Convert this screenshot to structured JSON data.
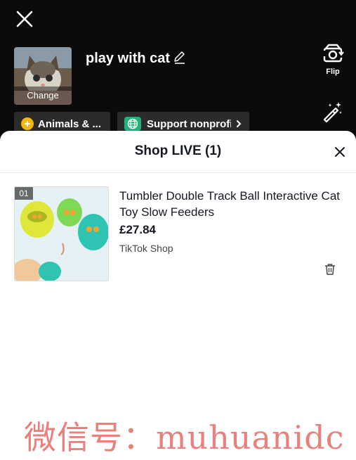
{
  "top": {
    "close_icon": "close-icon",
    "cover": {
      "change_label": "Change"
    },
    "title": "play with cat",
    "edit_icon": "pencil-icon",
    "flip": {
      "icon": "flip-camera-icon",
      "label": "Flip"
    },
    "effects_icon": "magic-wand-icon",
    "topic_pill": {
      "label": "Animals & ...",
      "icon": "topic-dot-icon"
    },
    "nonprofit_pill": {
      "label": "Support nonprofit",
      "icon": "globe-icon",
      "chevron": "chevron-right-icon"
    }
  },
  "sheet": {
    "title": "Shop LIVE (1)",
    "close_icon": "close-icon",
    "products": [
      {
        "index": "01",
        "name": "Tumbler Double Track Ball Interactive Cat Toy Slow Feeders",
        "price": "£27.84",
        "shop": "TikTok Shop",
        "delete_icon": "trash-icon"
      }
    ]
  },
  "watermark": "微信号：muhuanidc",
  "colors": {
    "top_background": "#0b0b0b",
    "pill_background": "#2b2b2b",
    "topic_dot": "#f5b50a",
    "globe_badge": "#21b37a",
    "watermark": "#e8736d"
  }
}
